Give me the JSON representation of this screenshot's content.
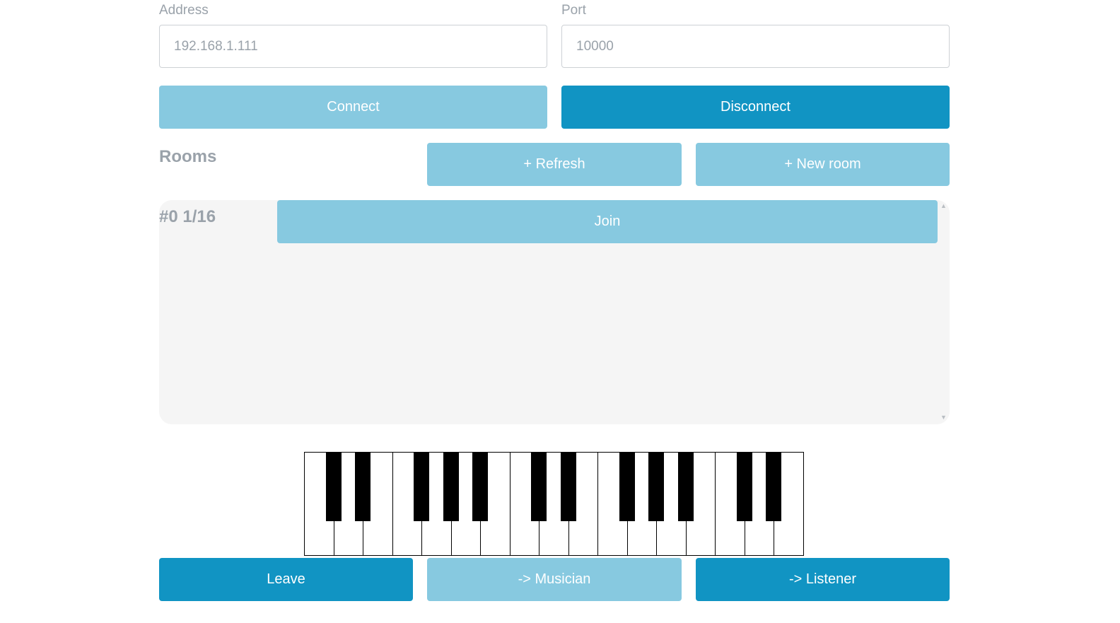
{
  "connection": {
    "address_label": "Address",
    "address_value": "192.168.1.111",
    "port_label": "Port",
    "port_value": "10000",
    "connect_label": "Connect",
    "disconnect_label": "Disconnect"
  },
  "rooms": {
    "heading": "Rooms",
    "refresh_label": "+ Refresh",
    "new_room_label": "+ New room",
    "items": [
      {
        "name": "#0 1/16",
        "join_label": "Join"
      }
    ]
  },
  "piano": {
    "white_keys": 17,
    "black_keys": 12
  },
  "actions": {
    "leave_label": "Leave",
    "musician_label": "-> Musician",
    "listener_label": "-> Listener"
  },
  "colors": {
    "button_light": "#87c9e0",
    "button_dark": "#1194c3",
    "label_gray": "#9aa2aa",
    "panel_bg": "#f5f5f5"
  }
}
